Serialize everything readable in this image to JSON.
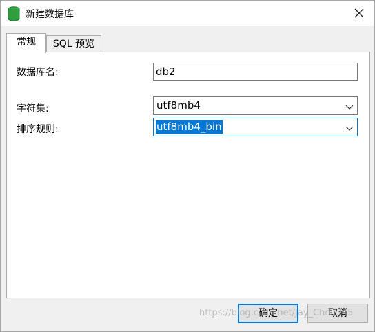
{
  "window": {
    "title": "新建数据库",
    "icon": "database-icon",
    "close_icon": "close-icon"
  },
  "tabs": [
    {
      "label": "常规",
      "active": true
    },
    {
      "label": "SQL 预览",
      "active": false
    }
  ],
  "form": {
    "db_name": {
      "label": "数据库名:",
      "value": "db2"
    },
    "charset": {
      "label": "字符集:",
      "value": "utf8mb4"
    },
    "collation": {
      "label": "排序规则:",
      "value": "utf8mb4_bin"
    }
  },
  "buttons": {
    "ok": "确定",
    "cancel": "取消"
  },
  "watermark": "https://blog.csdn.net/Jay_Chou345",
  "colors": {
    "accent": "#0078d7",
    "icon_green": "#2e9e3f"
  }
}
